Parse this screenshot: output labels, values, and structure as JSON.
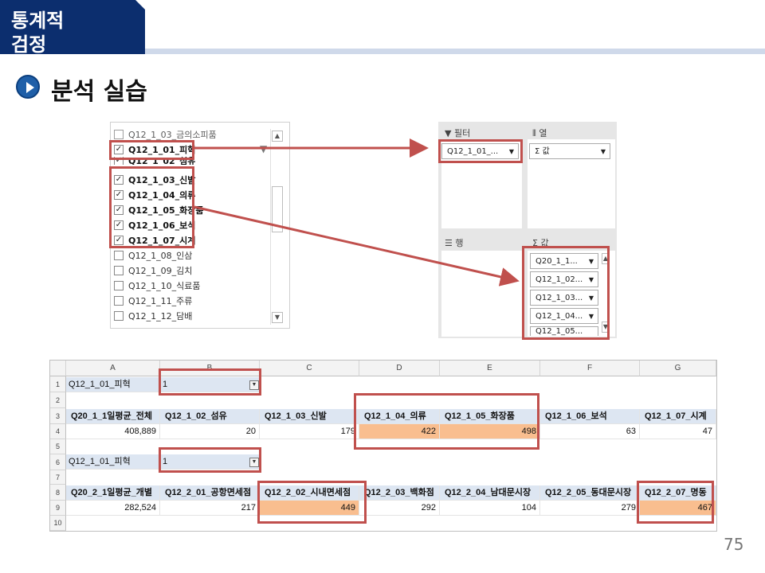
{
  "header": {
    "title_line1": "통계적",
    "title_line2": "검정"
  },
  "section_title": "분석 실습",
  "page_number": "75",
  "field_list": {
    "items": [
      {
        "label": "Q12_1_03_금의소피품",
        "checked": false,
        "bold": false
      },
      {
        "label": "Q12_1_01_피혁",
        "checked": true,
        "bold": true
      },
      {
        "label": "Q12_1_02_섬유",
        "checked": true,
        "bold": true
      },
      {
        "label": "Q12_1_03_신발",
        "checked": true,
        "bold": true
      },
      {
        "label": "Q12_1_04_의류",
        "checked": true,
        "bold": true
      },
      {
        "label": "Q12_1_05_화장품",
        "checked": true,
        "bold": true
      },
      {
        "label": "Q12_1_06_보석",
        "checked": true,
        "bold": true
      },
      {
        "label": "Q12_1_07_시계",
        "checked": true,
        "bold": true
      },
      {
        "label": "Q12_1_08_인삼",
        "checked": false,
        "bold": false
      },
      {
        "label": "Q12_1_09_김치",
        "checked": false,
        "bold": false
      },
      {
        "label": "Q12_1_10_식료품",
        "checked": false,
        "bold": false
      },
      {
        "label": "Q12_1_11_주류",
        "checked": false,
        "bold": false
      },
      {
        "label": "Q12_1_12_담배",
        "checked": false,
        "bold": false
      }
    ]
  },
  "pivot_areas": {
    "filter_label": "필터",
    "columns_label": "열",
    "rows_label": "행",
    "values_label": "값",
    "filter_chip": "Q12_1_01_...",
    "columns_chip": "Σ 값",
    "value_chips": [
      "Q20_1_1...",
      "Q12_1_02...",
      "Q12_1_03...",
      "Q12_1_04...",
      "Q12_1_05..."
    ]
  },
  "sheet": {
    "columns": [
      "A",
      "B",
      "C",
      "D",
      "E",
      "F",
      "G"
    ],
    "rows": [
      "1",
      "2",
      "3",
      "4",
      "5",
      "6",
      "7",
      "8",
      "9",
      "10"
    ],
    "filter1": {
      "label": "Q12_1_01_피혁",
      "value": "1"
    },
    "headers1": [
      "Q20_1_1일평균_전체",
      "Q12_1_02_섬유",
      "Q12_1_03_신발",
      "Q12_1_04_의류",
      "Q12_1_05_화장품",
      "Q12_1_06_보석",
      "Q12_1_07_시계"
    ],
    "values1": [
      "408,889",
      "20",
      "179",
      "422",
      "498",
      "63",
      "47"
    ],
    "filter2": {
      "label": "Q12_1_01_피혁",
      "value": "1"
    },
    "headers2": [
      "Q20_2_1일평균_개별",
      "Q12_2_01_공항면세점",
      "Q12_2_02_시내면세점",
      "Q12_2_03_백화점",
      "Q12_2_04_남대문시장",
      "Q12_2_05_동대문시장",
      "Q12_2_07_명동"
    ],
    "values2": [
      "282,524",
      "217",
      "449",
      "292",
      "104",
      "279",
      "467"
    ]
  },
  "colors": {
    "header_navy": "#0c2e6e",
    "highlight_box": "#c0504d",
    "cell_highlight": "#f9be8f",
    "pivot_header_fill": "#dde6f2"
  }
}
